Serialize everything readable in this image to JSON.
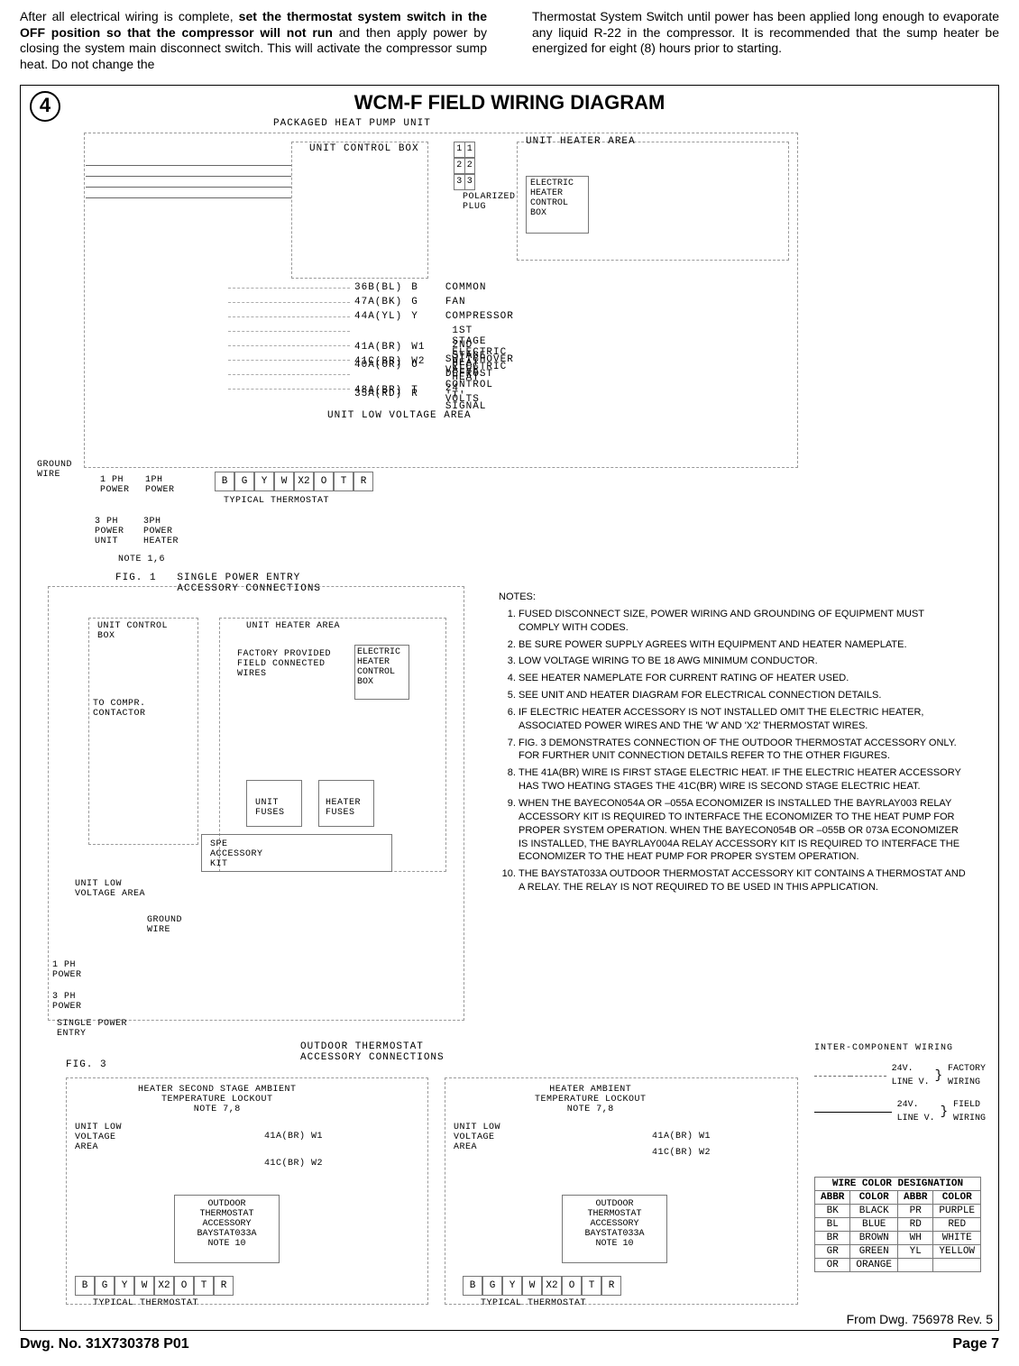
{
  "intro": {
    "left_a": "After all electrical wiring is complete, ",
    "left_b": "set the thermostat system switch in the OFF position so that the compressor will not run",
    "left_c": " and then apply power by closing the system main disconnect switch. This will activate the compressor sump heat.  Do not change the",
    "right": "Thermostat System Switch until power has been applied  long enough to evaporate any liquid R-22 in the compressor.  It is recommended that the sump heater be energized for eight (8) hours prior to starting."
  },
  "diagram": {
    "step": "4",
    "title": "WCM-F FIELD WIRING DIAGRAM",
    "top_unit": "PACKAGED HEAT PUMP UNIT",
    "ucb": "UNIT CONTROL BOX",
    "uha": "UNIT HEATER AREA",
    "pol": "POLARIZED\nPLUG",
    "ehcb": "ELECTRIC\nHEATER\nCONTROL\nBOX",
    "ulva": "UNIT LOW VOLTAGE AREA",
    "ground": "GROUND\nWIRE",
    "p1": "1 PH\nPOWER",
    "p1h": "1PH\nPOWER",
    "p3u": "3 PH\nPOWER\nUNIT",
    "p3h": "3PH\nPOWER\nHEATER",
    "note16": "NOTE 1,6",
    "typ_tstat": "TYPICAL THERMOSTAT",
    "terminals": [
      "B",
      "G",
      "Y",
      "W",
      "X2",
      "O",
      "T",
      "R"
    ],
    "conn": [
      [
        "1",
        "1"
      ],
      [
        "2",
        "2"
      ],
      [
        "3",
        "3"
      ]
    ],
    "wires": [
      {
        "code": "36B(BL)",
        "pin": "B",
        "desc": "COMMON"
      },
      {
        "code": "47A(BK)",
        "pin": "G",
        "desc": "FAN"
      },
      {
        "code": "44A(YL)",
        "pin": "Y",
        "desc": "COMPRESSOR"
      },
      {
        "code": "41A(BR)",
        "pin": "W1",
        "desc": "1ST STAGE ELECTRIC HEAT"
      },
      {
        "code": "41C(BR)",
        "pin": "W2",
        "desc": "2ND STAGE ELECTRIC HEAT"
      },
      {
        "code": "40A(OR)",
        "pin": "O",
        "desc": "SWITCHOVER VALVE"
      },
      {
        "code": "48A(BR)",
        "pin": "T",
        "desc": "DEFROST CONTROL 'T' SIGNAL"
      },
      {
        "code": "35A(RD)",
        "pin": "R",
        "desc": "24 VOLTS"
      }
    ],
    "fig1": {
      "title": "FIG. 1   SINGLE POWER ENTRY\n         ACCESSORY CONNECTIONS",
      "ucb": "UNIT CONTROL\nBOX",
      "uha": "UNIT HEATER AREA",
      "fpw": "FACTORY PROVIDED\nFIELD CONNECTED\nWIRES",
      "ehcb": "ELECTRIC\nHEATER\nCONTROL\nBOX",
      "toc": "TO COMPR.\nCONTACTOR",
      "uf": "UNIT\nFUSES",
      "hf": "HEATER\nFUSES",
      "spe": "SPE\nACCESSORY\nKIT",
      "ulva": "UNIT LOW\nVOLTAGE AREA",
      "ground": "GROUND\nWIRE",
      "p1": "1 PH\nPOWER",
      "p3": "3 PH\nPOWER",
      "bottom": "SINGLE POWER\nENTRY"
    },
    "fig3": {
      "header": "OUTDOOR THERMOSTAT\nACCESSORY CONNECTIONS",
      "name": "FIG. 3",
      "left_top": "HEATER SECOND STAGE AMBIENT\nTEMPERATURE LOCKOUT\nNOTE 7,8",
      "right_top": "HEATER AMBIENT\nTEMPERATURE LOCKOUT\nNOTE 7,8",
      "ulva": "UNIT LOW\nVOLTAGE\nAREA",
      "w1": "41A(BR) W1",
      "w2": "41C(BR) W2",
      "ota": "OUTDOOR\nTHERMOSTAT\nACCESSORY\nBAYSTAT033A\nNOTE 10",
      "typ": "TYPICAL THERMOSTAT"
    },
    "legend": {
      "title": "INTER-COMPONENT WIRING",
      "a": "24V.\nLINE V.",
      "fa": "FACTORY\nWIRING",
      "b": "24V.\nLINE V.",
      "fb": "FIELD\nWIRING"
    },
    "wct_title": "WIRE COLOR DESIGNATION",
    "wct_head": [
      "ABBR",
      "COLOR",
      "ABBR",
      "COLOR"
    ],
    "wct_rows": [
      [
        "BK",
        "BLACK",
        "PR",
        "PURPLE"
      ],
      [
        "BL",
        "BLUE",
        "RD",
        "RED"
      ],
      [
        "BR",
        "BROWN",
        "WH",
        "WHITE"
      ],
      [
        "GR",
        "GREEN",
        "YL",
        "YELLOW"
      ],
      [
        "OR",
        "ORANGE",
        "",
        ""
      ]
    ],
    "from": "From Dwg. 756978 Rev. 5"
  },
  "notes": {
    "header": "NOTES:",
    "items": [
      "FUSED DISCONNECT SIZE, POWER WIRING AND GROUNDING OF EQUIPMENT MUST COMPLY WITH CODES.",
      "BE SURE POWER SUPPLY AGREES WITH EQUIPMENT AND HEATER NAMEPLATE.",
      "LOW VOLTAGE WIRING TO BE 18 AWG MINIMUM CONDUCTOR.",
      "SEE HEATER NAMEPLATE FOR CURRENT RATING OF HEATER USED.",
      "SEE UNIT AND HEATER DIAGRAM FOR ELECTRICAL CONNECTION DETAILS.",
      "IF ELECTRIC HEATER ACCESSORY IS NOT INSTALLED OMIT THE ELECTRIC HEATER, ASSOCIATED POWER WIRES AND THE 'W' AND 'X2' THERMOSTAT WIRES.",
      "FIG. 3 DEMONSTRATES CONNECTION OF THE OUTDOOR THERMOSTAT ACCESSORY ONLY. FOR FURTHER UNIT CONNECTION DETAILS REFER TO THE OTHER FIGURES.",
      "THE 41A(BR) WIRE IS FIRST STAGE ELECTRIC HEAT. IF THE ELECTRIC HEATER ACCESSORY HAS TWO HEATING STAGES THE 41C(BR) WIRE IS SECOND STAGE ELECTRIC HEAT.",
      "WHEN THE BAYECON054A OR –055A ECONOMIZER IS INSTALLED THE BAYRLAY003 RELAY ACCESSORY KIT IS REQUIRED TO INTERFACE THE ECONOMIZER TO THE HEAT PUMP FOR PROPER SYSTEM OPERATION. WHEN THE  BAYECON054B OR –055B OR 073A ECONOMIZER IS INSTALLED, THE BAYRLAY004A RELAY ACCESSORY KIT IS REQUIRED TO INTERFACE THE ECONOMIZER TO THE HEAT PUMP FOR PROPER SYSTEM OPERATION.",
      "THE BAYSTAT033A OUTDOOR THERMOSTAT ACCESSORY KIT CONTAINS A THERMOSTAT AND A RELAY. THE RELAY IS NOT REQUIRED TO BE USED IN THIS APPLICATION."
    ]
  },
  "footer": {
    "left": "Dwg. No. 31X730378 P01",
    "right": "Page 7"
  }
}
